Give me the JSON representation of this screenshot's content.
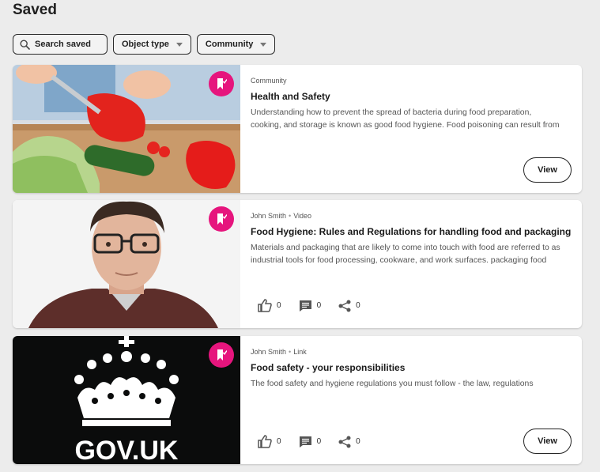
{
  "page": {
    "title": "Saved"
  },
  "filters": {
    "search_label": "Search saved",
    "object_type_label": "Object type",
    "community_label": "Community"
  },
  "cards": [
    {
      "meta_author": "",
      "meta_type": "Community",
      "title": "Health and Safety",
      "desc_line1": "Understanding how to prevent the spread of bacteria during food preparation,",
      "desc_line2": "cooking, and storage is known as good food hygiene. Food poisoning can result from",
      "view_label": "View"
    },
    {
      "meta_author": "John Smith",
      "meta_type": "Video",
      "title": "Food Hygiene: Rules and Regulations for handling food and packaging",
      "desc_line1": "Materials and packaging that are likely to come into touch with food are referred to as",
      "desc_line2": "industrial tools for food processing, cookware, and work surfaces. packaging food",
      "likes": "0",
      "comments": "0",
      "shares": "0"
    },
    {
      "meta_author": "John Smith",
      "meta_type": "Link",
      "title": "Food safety - your responsibilities",
      "desc_line1": "The food safety and hygiene regulations you must follow - the law, regulations",
      "likes": "0",
      "comments": "0",
      "shares": "0",
      "view_label": "View",
      "thumb_logo_text": "GOV.UK"
    }
  ],
  "icons": {
    "search": "search-icon",
    "caret": "caret-down-icon",
    "bookmark": "bookmark-check-icon",
    "like": "thumbs-up-icon",
    "comment": "comment-icon",
    "share": "share-icon"
  },
  "colors": {
    "accent": "#e6157d",
    "background": "#ececec",
    "card": "#ffffff",
    "thumb_dark": "#0b0c0c"
  }
}
